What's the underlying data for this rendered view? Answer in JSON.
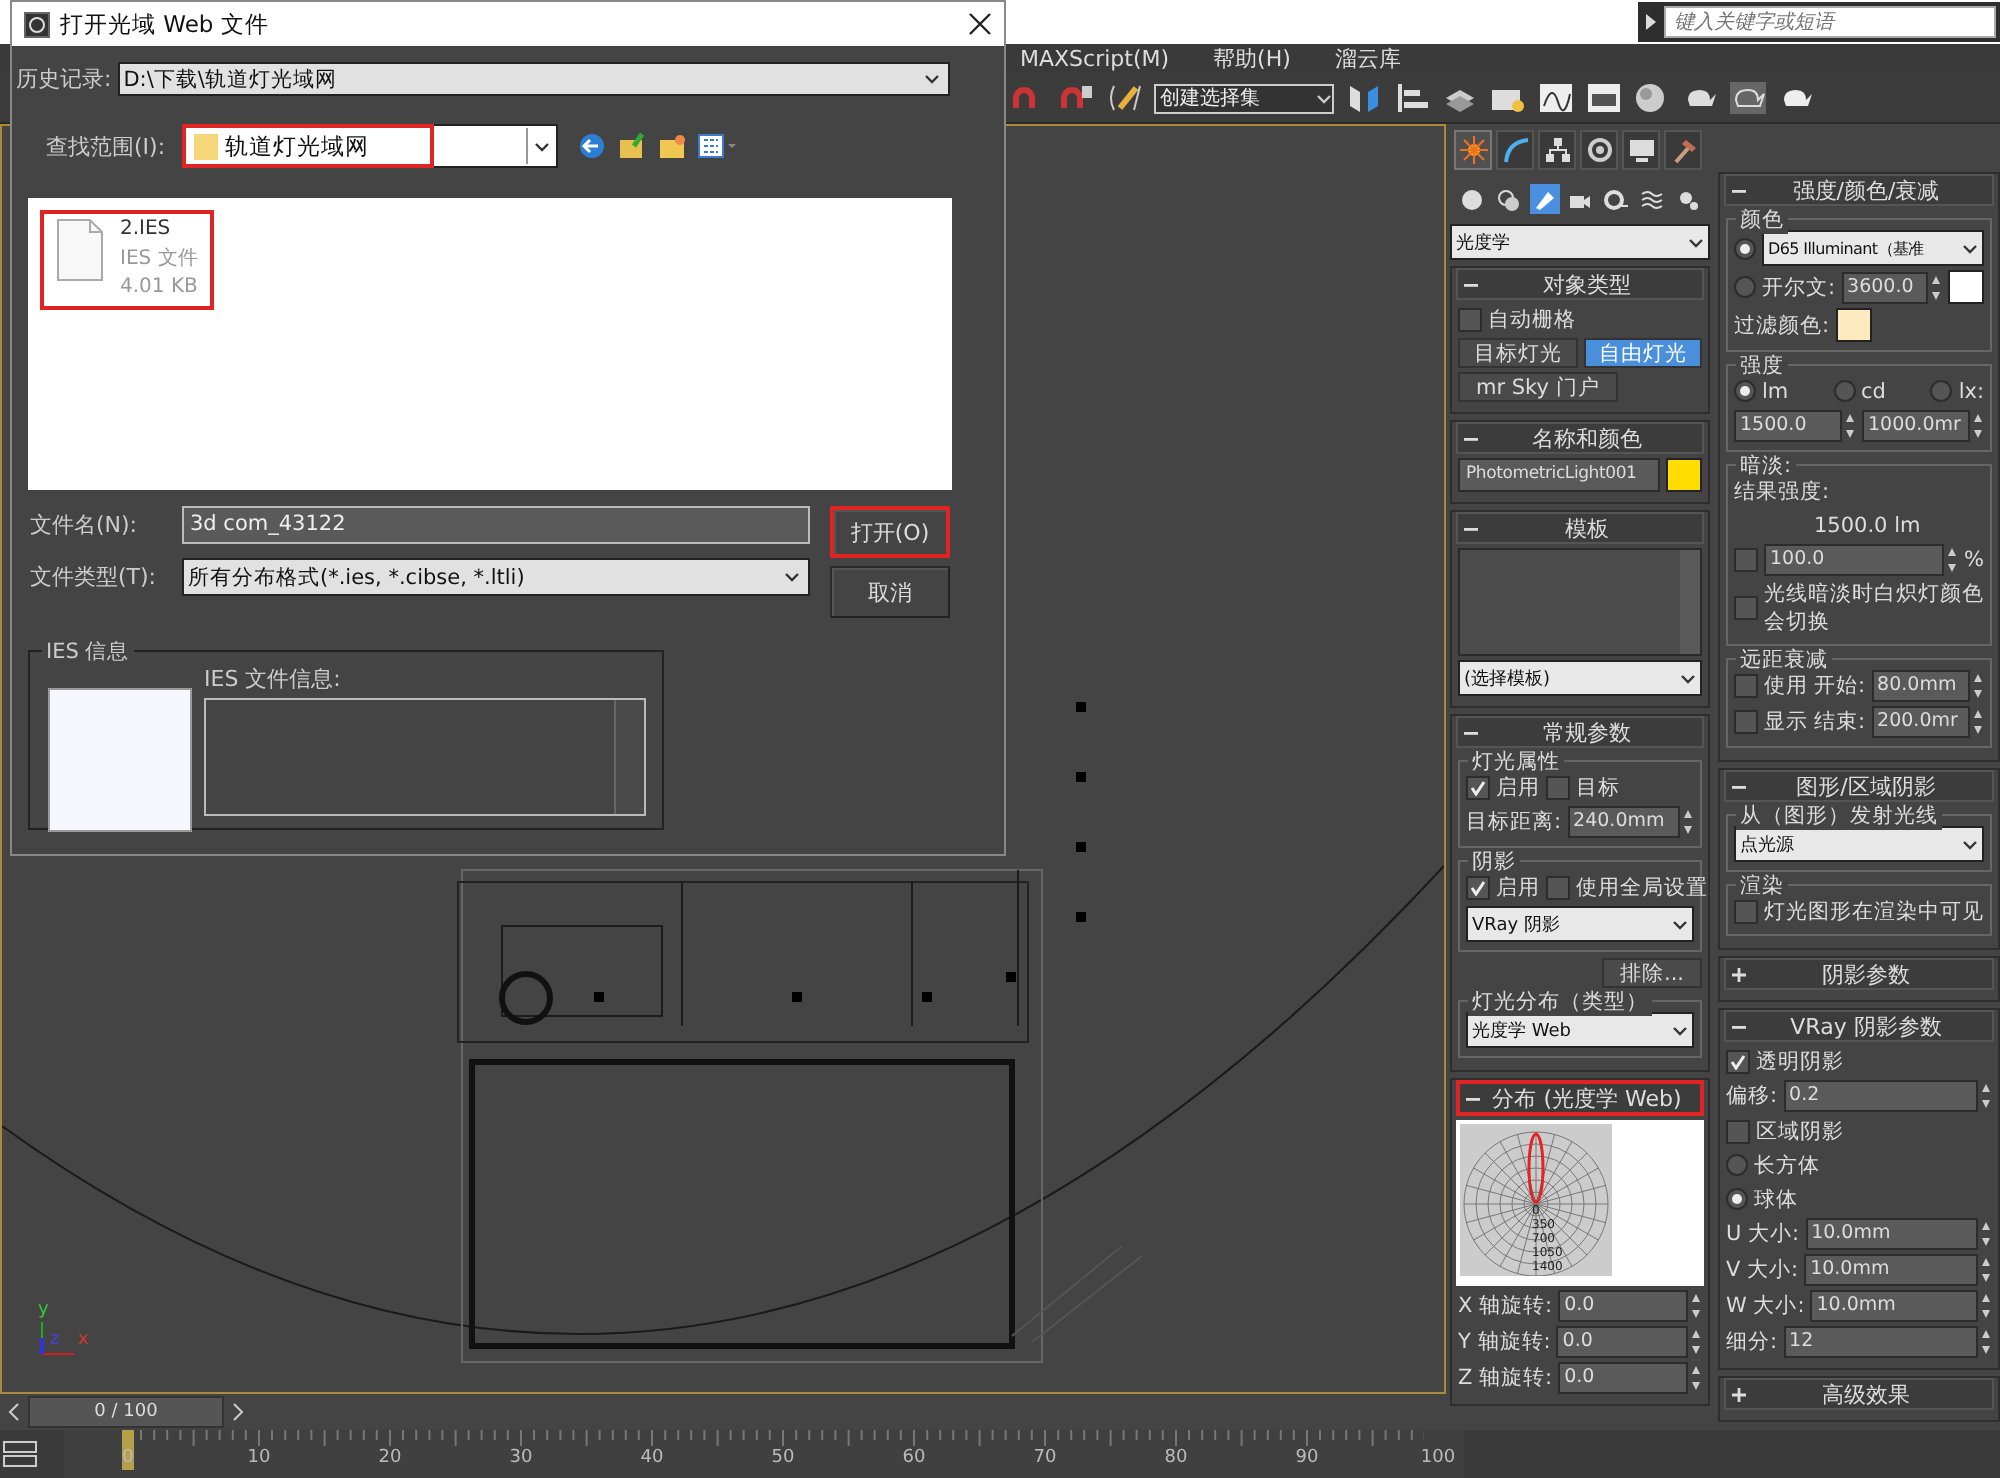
{
  "app": {
    "search": {
      "placeholder": "键入关键字或短语"
    },
    "menu": [
      "MAXScript(M)",
      "帮助(H)",
      "溜云库"
    ],
    "selection_set": "创建选择集"
  },
  "dialog": {
    "title": "打开光域 Web 文件",
    "history": {
      "label": "历史记录:",
      "value": "D:\\下载\\轨道灯光域网"
    },
    "look_in": {
      "label": "查找范围(I):",
      "value": "轨道灯光域网",
      "highlighted": true
    },
    "files": [
      {
        "name": "2.IES",
        "type": "IES 文件",
        "size": "4.01 KB",
        "highlighted": true
      }
    ],
    "filename": {
      "label": "文件名(N):",
      "value": "3d com_43122"
    },
    "filetype": {
      "label": "文件类型(T):",
      "value": "所有分布格式(*.ies, *.cibse, *.ltli)"
    },
    "buttons": [
      {
        "label": "打开(O)",
        "highlighted": true
      },
      {
        "label": "取消",
        "highlighted": false
      }
    ],
    "ies_info": {
      "title": "IES 信息",
      "file_info_label": "IES 文件信息:"
    }
  },
  "viewport": {
    "axes": [
      "y",
      "z",
      "x"
    ]
  },
  "timeline": {
    "frame": "0 / 100",
    "ticks": [
      "0",
      "10",
      "20",
      "30",
      "40",
      "50",
      "60",
      "70",
      "80",
      "90",
      "100"
    ]
  },
  "command_panel": {
    "tabs": [
      {
        "kind": "create",
        "selected": true
      },
      {
        "kind": "modify",
        "selected": false
      },
      {
        "kind": "hierarchy",
        "selected": false
      },
      {
        "kind": "motion",
        "selected": false
      },
      {
        "kind": "display",
        "selected": false
      },
      {
        "kind": "utilities",
        "selected": false
      }
    ],
    "categories": [
      {
        "kind": "geometry",
        "selected": false
      },
      {
        "kind": "shapes",
        "selected": false
      },
      {
        "kind": "lights",
        "selected": true
      },
      {
        "kind": "cameras",
        "selected": false
      },
      {
        "kind": "helpers",
        "selected": false
      },
      {
        "kind": "spacewarps",
        "selected": false
      },
      {
        "kind": "systems",
        "selected": false
      }
    ],
    "type_dropdown": "光度学",
    "left": [
      {
        "title": "对象类型",
        "expanded": true,
        "highlighted": false,
        "rows": [
          [
            {
              "kind": "checkbox",
              "label": "自动栅格",
              "checked": false
            }
          ],
          [
            {
              "kind": "button",
              "label": "目标灯光",
              "selected": false
            },
            {
              "kind": "button",
              "label": "自由灯光",
              "selected": true
            }
          ],
          [
            {
              "kind": "button",
              "label": "mr Sky 门户",
              "selected": false
            }
          ]
        ]
      },
      {
        "title": "名称和颜色",
        "expanded": true,
        "highlighted": false,
        "rows": [
          [
            {
              "kind": "field",
              "value": "PhotometricLight001"
            },
            {
              "kind": "swatch",
              "color": "#ffdd00"
            }
          ]
        ]
      },
      {
        "title": "模板",
        "expanded": true,
        "highlighted": false,
        "rows": [
          [
            {
              "kind": "listbox"
            }
          ],
          [
            {
              "kind": "dropdown",
              "value": "(选择模板)"
            }
          ]
        ]
      },
      {
        "title": "常规参数",
        "expanded": true,
        "highlighted": false,
        "rows": [
          {
            "kind": "group",
            "title": "灯光属性",
            "rows": [
              [
                {
                  "kind": "checkbox",
                  "label": "启用",
                  "checked": true
                },
                {
                  "kind": "checkbox",
                  "label": "目标",
                  "checked": false
                }
              ],
              [
                {
                  "kind": "label",
                  "text": "目标距离:"
                },
                {
                  "kind": "spinner",
                  "value": "240.0mm"
                }
              ]
            ]
          },
          {
            "kind": "group",
            "title": "阴影",
            "rows": [
              [
                {
                  "kind": "checkbox",
                  "label": "启用",
                  "checked": true
                },
                {
                  "kind": "checkbox",
                  "label": "使用全局设置",
                  "checked": false
                }
              ],
              [
                {
                  "kind": "dropdown",
                  "value": "VRay 阴影"
                }
              ]
            ]
          },
          [
            {
              "kind": "button",
              "label": "排除...",
              "selected": false
            }
          ],
          {
            "kind": "group",
            "title": "灯光分布（类型）",
            "rows": [
              [
                {
                  "kind": "dropdown",
                  "value": "光度学 Web"
                }
              ]
            ]
          }
        ]
      },
      {
        "title": "分布 (光度学 Web)",
        "expanded": true,
        "highlighted": true,
        "rows": [
          {
            "kind": "web",
            "labels": [
              "0",
              "350",
              "700",
              "1050",
              "1400"
            ]
          },
          [
            {
              "kind": "label",
              "text": "X 轴旋转:"
            },
            {
              "kind": "spinner",
              "value": "0.0"
            }
          ],
          [
            {
              "kind": "label",
              "text": "Y 轴旋转:"
            },
            {
              "kind": "spinner",
              "value": "0.0"
            }
          ],
          [
            {
              "kind": "label",
              "text": "Z 轴旋转:"
            },
            {
              "kind": "spinner",
              "value": "0.0"
            }
          ]
        ]
      }
    ],
    "right": [
      {
        "title": "强度/颜色/衰减",
        "expanded": true,
        "highlighted": false,
        "rows": [
          {
            "kind": "group",
            "title": "颜色",
            "rows": [
              [
                {
                  "kind": "radio",
                  "selected": true
                },
                {
                  "kind": "dropdown",
                  "value": "D65 Illuminant（基准"
                }
              ],
              [
                {
                  "kind": "radio",
                  "label": "开尔文:",
                  "selected": false
                },
                {
                  "kind": "spinner",
                  "value": "3600.0"
                },
                {
                  "kind": "swatch",
                  "color": "#ffffff"
                }
              ],
              [
                {
                  "kind": "label",
                  "text": "过滤颜色:"
                },
                {
                  "kind": "swatch",
                  "color": "#ffe9bf"
                }
              ]
            ]
          },
          {
            "kind": "group",
            "title": "强度",
            "rows": [
              [
                {
                  "kind": "radio",
                  "label": "lm",
                  "selected": true
                },
                {
                  "kind": "radio",
                  "label": "cd",
                  "selected": false
                },
                {
                  "kind": "radio",
                  "label": "lx:",
                  "selected": false
                }
              ],
              [
                {
                  "kind": "spinner",
                  "value": "1500.0"
                },
                {
                  "kind": "spinner",
                  "value": "1000.0mr"
                }
              ]
            ]
          },
          {
            "kind": "group",
            "title": "暗淡:",
            "rows": [
              [
                {
                  "kind": "label",
                  "text": "结果强度:"
                }
              ],
              [
                {
                  "kind": "text",
                  "text": "1500.0 lm"
                }
              ],
              [
                {
                  "kind": "checkbox",
                  "checked": false
                },
                {
                  "kind": "spinner",
                  "value": "100.0"
                },
                {
                  "kind": "label",
                  "text": "%"
                }
              ],
              [
                {
                  "kind": "checkbox",
                  "label": "光线暗淡时白炽灯颜色会切换",
                  "checked": false
                }
              ]
            ]
          },
          {
            "kind": "group",
            "title": "远距衰减",
            "rows": [
              [
                {
                  "kind": "checkbox",
                  "label": "使用",
                  "checked": false
                },
                {
                  "kind": "label",
                  "text": "开始:"
                },
                {
                  "kind": "spinner",
                  "value": "80.0mm"
                }
              ],
              [
                {
                  "kind": "checkbox",
                  "label": "显示",
                  "checked": false
                },
                {
                  "kind": "label",
                  "text": "结束:"
                },
                {
                  "kind": "spinner",
                  "value": "200.0mr"
                }
              ]
            ]
          }
        ]
      },
      {
        "title": "图形/区域阴影",
        "expanded": true,
        "highlighted": false,
        "rows": [
          {
            "kind": "group",
            "title": "从（图形）发射光线",
            "rows": [
              [
                {
                  "kind": "dropdown",
                  "value": "点光源"
                }
              ]
            ]
          },
          {
            "kind": "group",
            "title": "渲染",
            "rows": [
              [
                {
                  "kind": "checkbox",
                  "label": "灯光图形在渲染中可见",
                  "checked": false
                }
              ]
            ]
          }
        ]
      },
      {
        "title": "阴影参数",
        "expanded": false,
        "highlighted": false
      },
      {
        "title": "VRay 阴影参数",
        "expanded": true,
        "highlighted": false,
        "rows": [
          [
            {
              "kind": "checkbox",
              "label": "透明阴影",
              "checked": true
            }
          ],
          [
            {
              "kind": "label",
              "text": "偏移:"
            },
            {
              "kind": "spinner",
              "value": "0.2"
            }
          ],
          [
            {
              "kind": "checkbox",
              "label": "区域阴影",
              "checked": false
            }
          ],
          [
            {
              "kind": "radio",
              "label": "长方体",
              "selected": false
            }
          ],
          [
            {
              "kind": "radio",
              "label": "球体",
              "selected": true
            }
          ],
          [
            {
              "kind": "label",
              "text": "U 大小:"
            },
            {
              "kind": "spinner",
              "value": "10.0mm"
            }
          ],
          [
            {
              "kind": "label",
              "text": "V 大小:"
            },
            {
              "kind": "spinner",
              "value": "10.0mm"
            }
          ],
          [
            {
              "kind": "label",
              "text": "W 大小:"
            },
            {
              "kind": "spinner",
              "value": "10.0mm"
            }
          ],
          [
            {
              "kind": "label",
              "text": "细分:"
            },
            {
              "kind": "spinner",
              "value": "12"
            }
          ]
        ]
      },
      {
        "title": "高级效果",
        "expanded": false,
        "highlighted": false
      }
    ]
  }
}
